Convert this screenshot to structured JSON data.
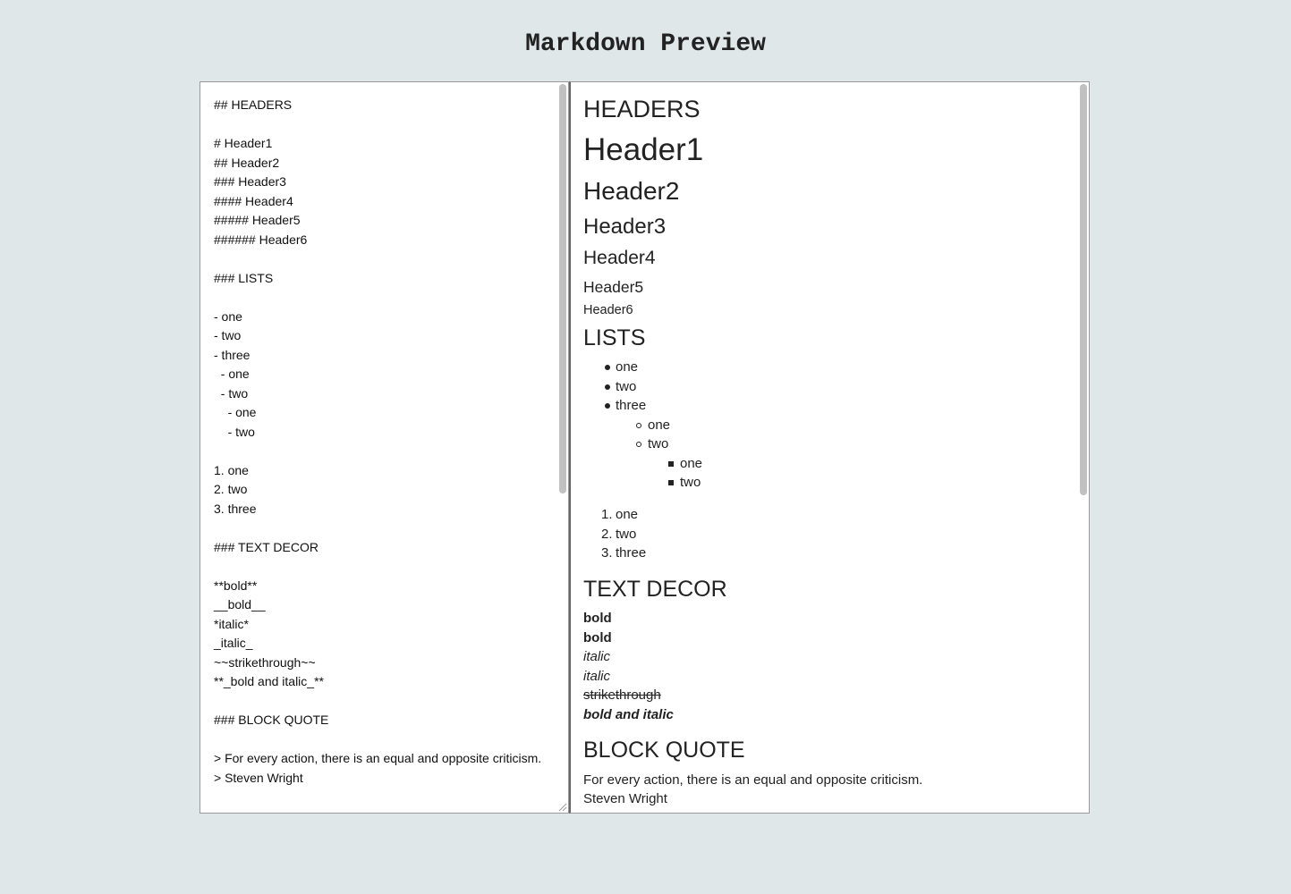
{
  "app_title": "Markdown Preview",
  "editor": {
    "content": "## HEADERS\n\n# Header1\n## Header2\n### Header3\n#### Header4\n##### Header5\n###### Header6\n\n### LISTS\n\n- one\n- two\n- three\n  - one\n  - two\n    - one\n    - two\n\n1. one\n2. two\n3. three\n\n### TEXT DECOR\n\n**bold**\n__bold__\n*italic*\n_italic_\n~~strikethrough~~\n**_bold and italic_**\n\n### BLOCK QUOTE\n\n> For every action, there is an equal and opposite criticism.\n> Steven Wright"
  },
  "preview": {
    "headers_title": "HEADERS",
    "header1": "Header1",
    "header2": "Header2",
    "header3": "Header3",
    "header4": "Header4",
    "header5": "Header5",
    "header6": "Header6",
    "lists_title": "LISTS",
    "ul": {
      "l1": [
        "one",
        "two",
        "three"
      ],
      "l2": [
        "one",
        "two"
      ],
      "l3": [
        "one",
        "two"
      ]
    },
    "ol": [
      "one",
      "two",
      "three"
    ],
    "decor_title": "TEXT DECOR",
    "bold1": "bold",
    "bold2": "bold",
    "italic1": "italic",
    "italic2": "italic",
    "strike": "strikethrough",
    "bold_italic": "bold and italic",
    "quote_title": "BLOCK QUOTE",
    "quote_line1": "For every action, there is an equal and opposite criticism.",
    "quote_line2": "Steven Wright"
  }
}
